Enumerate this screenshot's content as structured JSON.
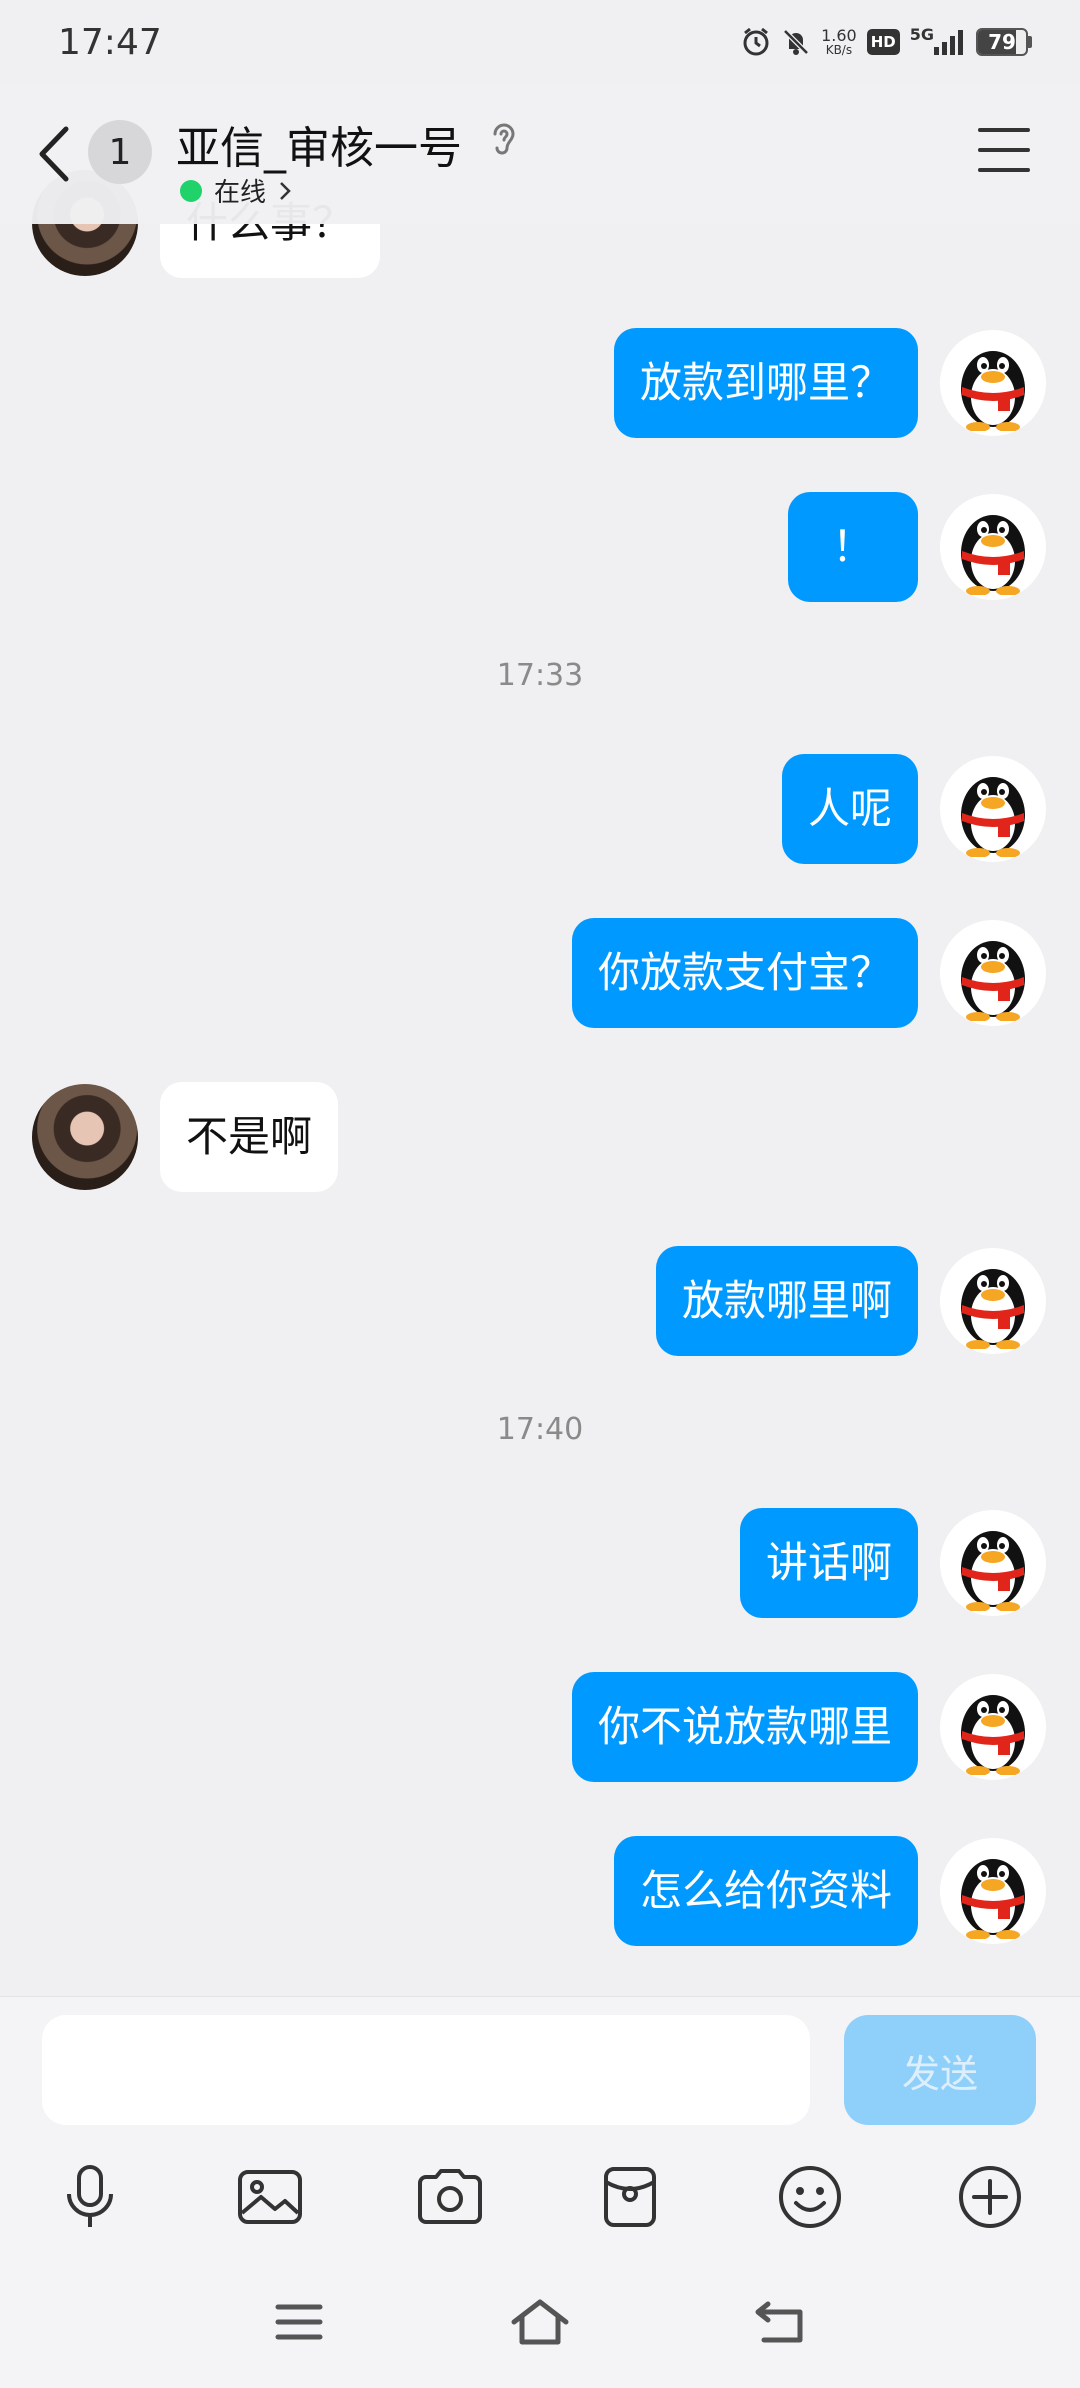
{
  "status": {
    "time": "17:47",
    "net_speed_value": "1.60",
    "net_speed_unit": "KB/s",
    "hd_label": "HD",
    "network_label": "5G",
    "battery": "79",
    "icons": [
      "alarm-icon",
      "mute-bell-icon",
      "signal-icon"
    ]
  },
  "header": {
    "unread_count": "1",
    "contact_name": "亚信_审核一号",
    "online_status": "在线",
    "icons": [
      "back-arrow-icon",
      "ear-icon",
      "chevron-right-icon",
      "menu-icon"
    ]
  },
  "messages": [
    {
      "side": "in",
      "text": "什么事？"
    },
    {
      "side": "out",
      "text": "放款到哪里？"
    },
    {
      "side": "out",
      "text": "！"
    },
    {
      "timestamp": "17:33"
    },
    {
      "side": "out",
      "text": "人呢"
    },
    {
      "side": "out",
      "text": "你放款支付宝？"
    },
    {
      "side": "in",
      "text": "不是啊"
    },
    {
      "side": "out",
      "text": "放款哪里啊"
    },
    {
      "timestamp": "17:40"
    },
    {
      "side": "out",
      "text": "讲话啊"
    },
    {
      "side": "out",
      "text": "你不说放款哪里"
    },
    {
      "side": "out",
      "text": "怎么给你资料"
    }
  ],
  "composer": {
    "input_value": "",
    "send_label": "发送"
  },
  "toolbar": [
    "microphone-icon",
    "image-icon",
    "camera-icon",
    "red-packet-icon",
    "emoji-icon",
    "plus-icon"
  ],
  "nav": [
    "menu-icon",
    "home-icon",
    "back-icon"
  ],
  "colors": {
    "outgoing_bubble": "#0099ff",
    "incoming_bubble": "#ffffff",
    "online_dot": "#1fd36a",
    "send_button_disabled": "#8fd0fb"
  }
}
